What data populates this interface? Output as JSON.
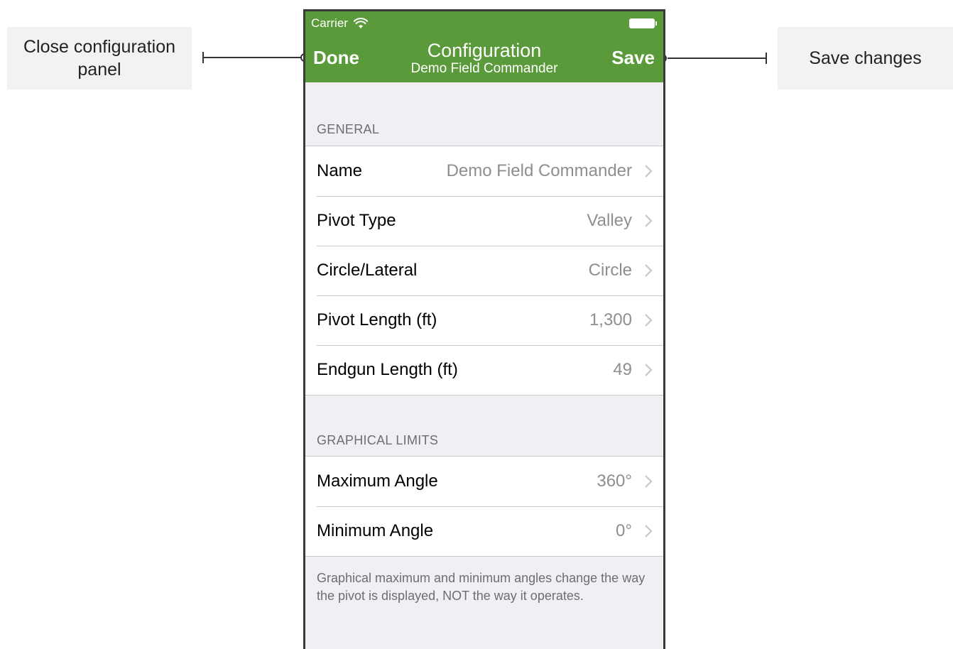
{
  "annotations": {
    "done_callout": "Close configuration panel",
    "save_callout": "Save changes"
  },
  "status_bar": {
    "carrier": "Carrier",
    "wifi_icon": "wifi-icon",
    "battery_icon": "battery-icon"
  },
  "navbar": {
    "done_label": "Done",
    "title": "Configuration",
    "subtitle": "Demo Field Commander",
    "save_label": "Save",
    "background_color": "#5a9a3a"
  },
  "sections": {
    "general": {
      "header": "GENERAL",
      "rows": [
        {
          "label": "Name",
          "value": "Demo Field Commander"
        },
        {
          "label": "Pivot Type",
          "value": "Valley"
        },
        {
          "label": "Circle/Lateral",
          "value": "Circle"
        },
        {
          "label": "Pivot Length (ft)",
          "value": "1,300"
        },
        {
          "label": "Endgun Length (ft)",
          "value": "49"
        }
      ]
    },
    "graphical_limits": {
      "header": "GRAPHICAL LIMITS",
      "rows": [
        {
          "label": "Maximum Angle",
          "value": "360°"
        },
        {
          "label": "Minimum Angle",
          "value": "0°"
        }
      ],
      "footer": "Graphical maximum and minimum angles change the way the pivot is displayed, NOT the way it operates."
    }
  }
}
